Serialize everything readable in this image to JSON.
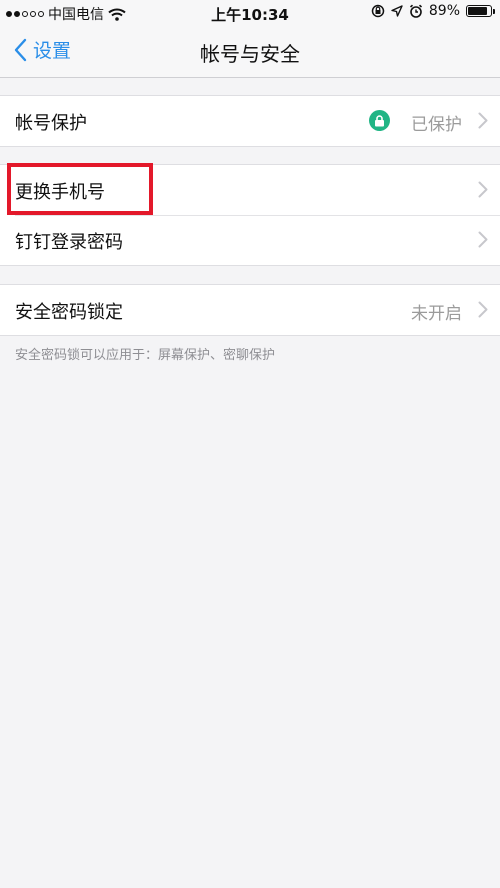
{
  "status_bar": {
    "carrier": "中国电信",
    "time": "上午10:34",
    "battery": "89%",
    "battery_level": 0.89,
    "signal_bars_filled": 2,
    "signal_bars_total": 5
  },
  "nav": {
    "back_label": "设置",
    "title": "帐号与安全"
  },
  "sections": {
    "account_protection": {
      "label": "帐号保护",
      "value": "已保护",
      "icon": "lock-icon",
      "icon_color": "#21b585"
    },
    "change_phone": {
      "label": "更换手机号",
      "highlight_color": "#e3182a"
    },
    "login_password": {
      "label": "钉钉登录密码"
    },
    "security_lock": {
      "label": "安全密码锁定",
      "value": "未开启",
      "note": "安全密码锁可以应用于：屏幕保护、密聊保护"
    }
  },
  "colors": {
    "accent": "#2a8ee8",
    "background": "#f4f4f6"
  }
}
